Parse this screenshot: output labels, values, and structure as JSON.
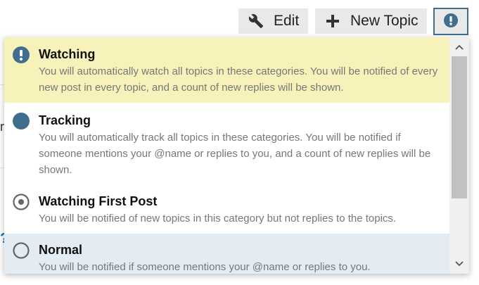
{
  "toolbar": {
    "edit_label": "Edit",
    "new_topic_label": "New Topic"
  },
  "background": {
    "glyph": "r",
    "help_glyph": "?"
  },
  "dropdown": {
    "items": [
      {
        "title": "Watching",
        "description": "You will automatically watch all topics in these categories. You will be notified of every new post in every topic, and a count of new replies will be shown.",
        "icon": "exclamation-circle-icon",
        "state": "highlighted"
      },
      {
        "title": "Tracking",
        "description": "You will automatically track all topics in these categories. You will be notified if someone mentions your @name or replies to you, and a count of new replies will be shown.",
        "icon": "filled-circle-icon"
      },
      {
        "title": "Watching First Post",
        "description": "You will be notified of new topics in this category but not replies to the topics.",
        "icon": "dot-circle-icon"
      },
      {
        "title": "Normal",
        "description": "You will be notified if someone mentions your @name or replies to you.",
        "icon": "empty-circle-icon",
        "state": "hover"
      }
    ]
  },
  "colors": {
    "accent": "#3f6e8e",
    "highlight": "#f6f2ba",
    "hover": "#e3ecf2"
  }
}
